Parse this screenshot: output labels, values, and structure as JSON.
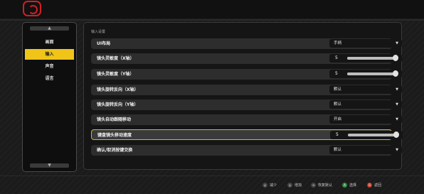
{
  "sidebar": {
    "items": [
      {
        "label": "画面",
        "active": false
      },
      {
        "label": "输入",
        "active": true
      },
      {
        "label": "声音",
        "active": false
      },
      {
        "label": "语言",
        "active": false
      }
    ]
  },
  "panel": {
    "section_title": "输入设置",
    "rows": [
      {
        "label": "UI布局",
        "type": "dropdown",
        "value": "手柄",
        "focused": false
      },
      {
        "label": "镜头灵敏度（X轴）",
        "type": "slider",
        "value": "5",
        "level": 1.0,
        "focused": false
      },
      {
        "label": "镜头灵敏度（Y轴）",
        "type": "slider",
        "value": "5",
        "level": 1.0,
        "focused": false
      },
      {
        "label": "镜头旋转反向（X轴）",
        "type": "dropdown",
        "value": "默认",
        "focused": false
      },
      {
        "label": "镜头旋转反向（Y轴）",
        "type": "dropdown",
        "value": "默认",
        "focused": false
      },
      {
        "label": "镜头自动跟随移动",
        "type": "dropdown",
        "value": "开启",
        "focused": false
      },
      {
        "label": "键盘镜头移动速度",
        "type": "slider",
        "value": "5",
        "level": 1.0,
        "focused": true
      },
      {
        "label": "确认/取消按键交换",
        "type": "dropdown",
        "value": "默认",
        "focused": false
      }
    ]
  },
  "footer": {
    "hints": [
      {
        "glyph": "◎",
        "label": "减少",
        "style": "dark"
      },
      {
        "glyph": "◎",
        "label": "增加",
        "style": "dark"
      },
      {
        "glyph": "⟲",
        "label": "恢复默认",
        "style": "dark"
      },
      {
        "glyph": "A",
        "label": "选择",
        "style": "green"
      },
      {
        "glyph": "B",
        "label": "返回",
        "style": "red"
      }
    ]
  },
  "colors": {
    "accent": "#f0c419",
    "brand_red": "#d11f24",
    "focus_border": "#d8b13a"
  }
}
